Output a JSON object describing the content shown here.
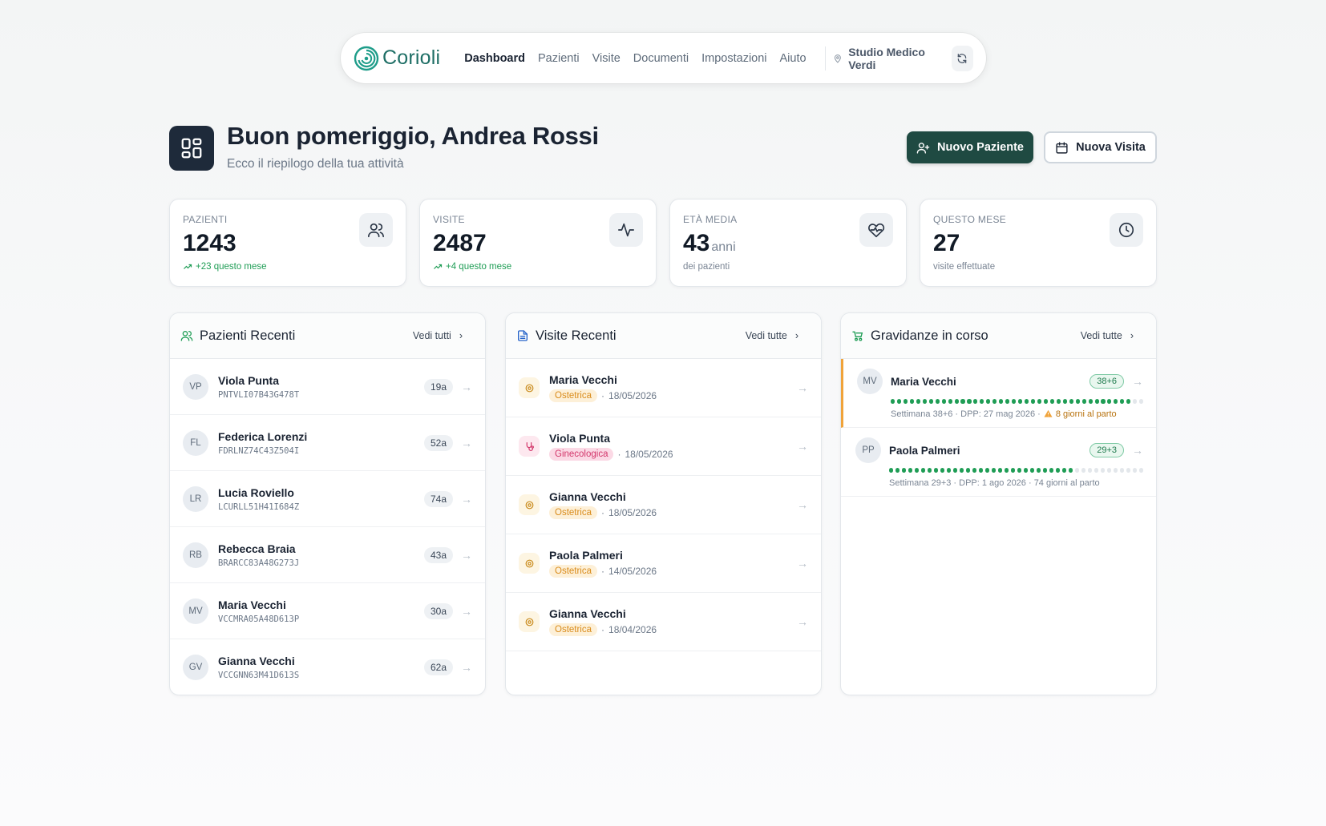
{
  "nav": {
    "brand": "Corioli",
    "links": [
      "Dashboard",
      "Pazienti",
      "Visite",
      "Documenti",
      "Impostazioni",
      "Aiuto"
    ],
    "active": "Dashboard",
    "location": "Studio Medico Verdi",
    "brand_color": "#1f6f66"
  },
  "header": {
    "greeting": "Buon pomeriggio, Andrea Rossi",
    "subtitle": "Ecco il riepilogo della tua attività",
    "new_patient": "Nuovo Paziente",
    "new_visit": "Nuova Visita"
  },
  "stats": [
    {
      "label": "PAZIENTI",
      "value": "1243",
      "unit": "",
      "foot": "+23 questo mese",
      "trend": true,
      "icon": "users-icon"
    },
    {
      "label": "VISITE",
      "value": "2487",
      "unit": "",
      "foot": "+4 questo mese",
      "trend": true,
      "icon": "activity-icon"
    },
    {
      "label": "ETÀ MEDIA",
      "value": "43",
      "unit": "anni",
      "foot": "dei pazienti",
      "trend": false,
      "icon": "heart-pulse-icon"
    },
    {
      "label": "QUESTO MESE",
      "value": "27",
      "unit": "",
      "foot": "visite effettuate",
      "trend": false,
      "icon": "clock-icon"
    }
  ],
  "patients": {
    "title": "Pazienti Recenti",
    "link": "Vedi tutti",
    "rows": [
      {
        "initials": "VP",
        "name": "Viola Punta",
        "code": "PNTVLI07B43G478T",
        "age": "19a"
      },
      {
        "initials": "FL",
        "name": "Federica Lorenzi",
        "code": "FDRLNZ74C43Z504I",
        "age": "52a"
      },
      {
        "initials": "LR",
        "name": "Lucia Roviello",
        "code": "LCURLL51H41I684Z",
        "age": "74a"
      },
      {
        "initials": "RB",
        "name": "Rebecca Braia",
        "code": "BRARCC83A48G273J",
        "age": "43a"
      },
      {
        "initials": "MV",
        "name": "Maria Vecchi",
        "code": "VCCMRA05A48D613P",
        "age": "30a"
      },
      {
        "initials": "GV",
        "name": "Gianna Vecchi",
        "code": "VCCGNN63M41D613S",
        "age": "62a"
      }
    ]
  },
  "visits": {
    "title": "Visite Recenti",
    "link": "Vedi tutte",
    "rows": [
      {
        "name": "Maria Vecchi",
        "type": "Ostetrica",
        "kind": "ost",
        "date": "18/05/2026"
      },
      {
        "name": "Viola Punta",
        "type": "Ginecologica",
        "kind": "gin",
        "date": "18/05/2026"
      },
      {
        "name": "Gianna Vecchi",
        "type": "Ostetrica",
        "kind": "ost",
        "date": "18/05/2026"
      },
      {
        "name": "Paola Palmeri",
        "type": "Ostetrica",
        "kind": "ost",
        "date": "14/05/2026"
      },
      {
        "name": "Gianna Vecchi",
        "type": "Ostetrica",
        "kind": "ost",
        "date": "18/04/2026"
      }
    ]
  },
  "pregnancies": {
    "title": "Gravidanze in corso",
    "link": "Vedi tutte",
    "rows": [
      {
        "initials": "MV",
        "name": "Maria Vecchi",
        "week": "38+6",
        "progress_weeks": 38,
        "total_weeks": 40,
        "info": "Settimana 38+6 · DPP: 27 mag 2026 ·",
        "warning": "8 giorni al parto"
      },
      {
        "initials": "PP",
        "name": "Paola Palmeri",
        "week": "29+3",
        "progress_weeks": 29,
        "total_weeks": 40,
        "info": "Settimana 29+3 · DPP: 1 ago 2026 · 74 giorni al parto",
        "warning": ""
      }
    ]
  },
  "colors": {
    "green": "#1f9d55",
    "dark": "#1f4a42",
    "ostetrica": "#d98b1a",
    "ginecologica": "#d3376b",
    "warning": "#f0a33a"
  }
}
